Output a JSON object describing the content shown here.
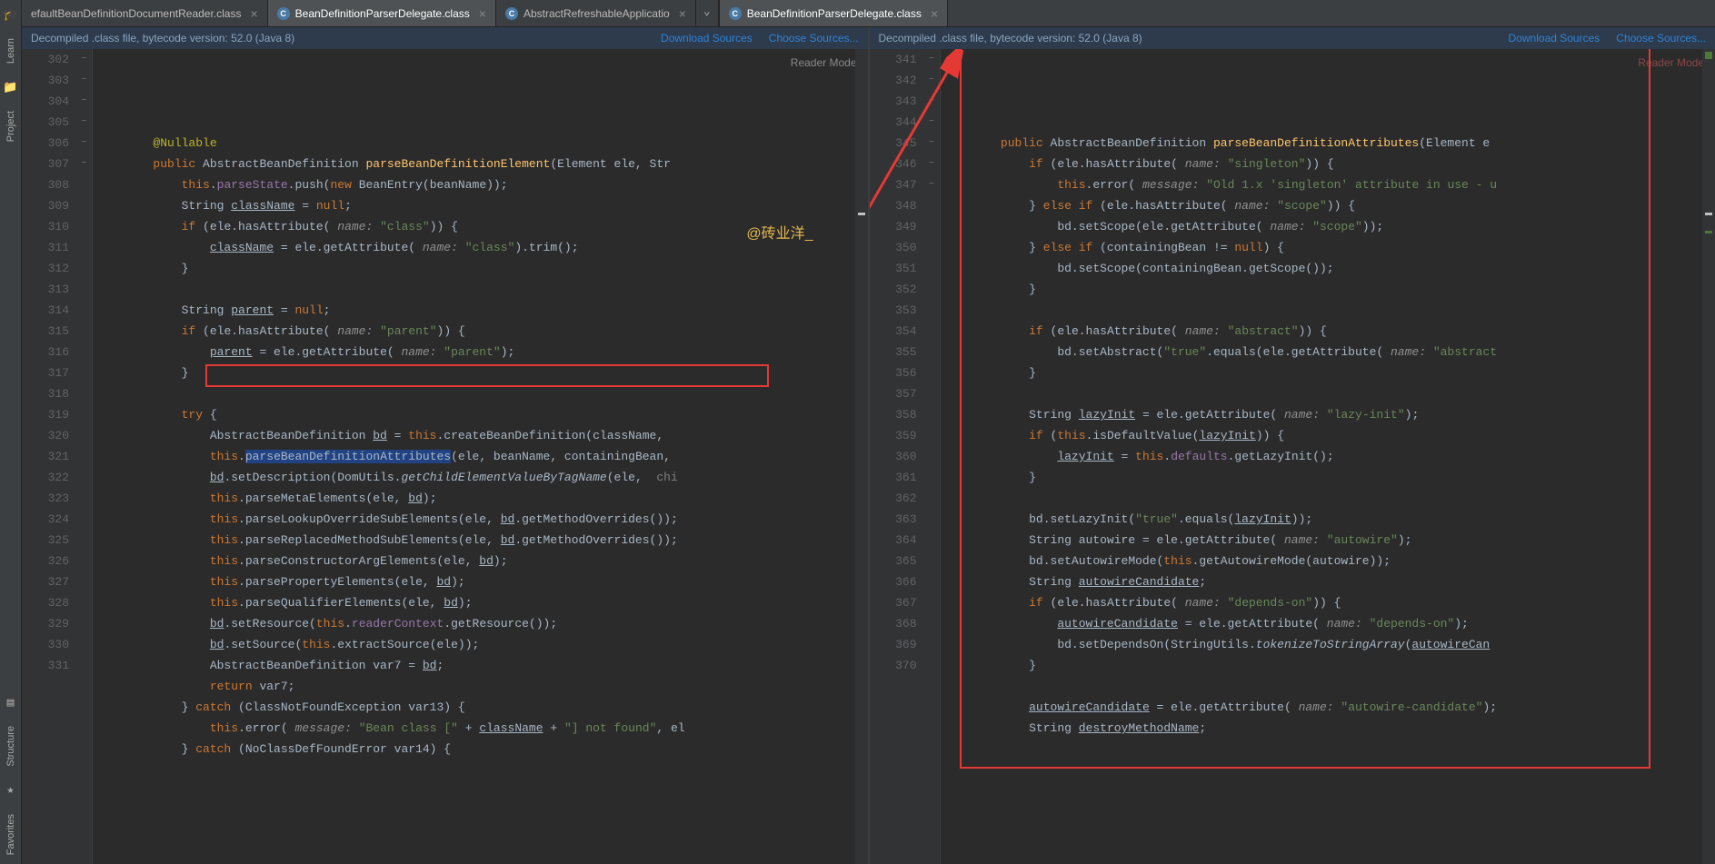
{
  "sidebar": {
    "items": [
      "Learn",
      "Project",
      "Structure",
      "Favorites"
    ]
  },
  "tabs_left": [
    {
      "label": "efaultBeanDefinitionDocumentReader.class",
      "active": false,
      "icon": ""
    },
    {
      "label": "BeanDefinitionParserDelegate.class",
      "active": true,
      "icon": "C"
    },
    {
      "label": "AbstractRefreshableApplicatio",
      "active": false,
      "icon": "C"
    }
  ],
  "tabs_right": [
    {
      "label": "BeanDefinitionParserDelegate.class",
      "active": true,
      "icon": "C"
    }
  ],
  "info": {
    "text": "Decompiled .class file, bytecode version: 52.0 (Java 8)",
    "download": "Download Sources",
    "choose": "Choose Sources..."
  },
  "reader_mode": "Reader Mode",
  "watermark": "@砖业洋_",
  "left": {
    "start": 302,
    "fold": [
      "",
      "−",
      "",
      "",
      "",
      "−",
      "",
      "",
      "",
      "",
      "",
      "−",
      "",
      "",
      "",
      "−",
      "",
      "",
      "",
      "",
      "",
      "",
      "",
      "",
      "",
      "",
      "",
      "−",
      "",
      "−"
    ],
    "lines": [
      "        <span class='ann'>@Nullable</span>",
      "        <span class='kw'>public</span> AbstractBeanDefinition <span class='method'>parseBeanDefinitionElement</span>(Element ele, Str",
      "            <span class='kw'>this</span>.<span class='var'>parseState</span>.push(<span class='kw'>new</span> BeanEntry(beanName));",
      "            String <span class='under'>className</span> = <span class='kw'>null</span>;",
      "            <span class='kw'>if</span> (ele.hasAttribute( <span class='param'>name:</span> <span class='str'>\"class\"</span>)) {",
      "                <span class='under'>className</span> = ele.getAttribute( <span class='param'>name:</span> <span class='str'>\"class\"</span>).trim();",
      "            }",
      "",
      "            String <span class='under'>parent</span> = <span class='kw'>null</span>;",
      "            <span class='kw'>if</span> (ele.hasAttribute( <span class='param'>name:</span> <span class='str'>\"parent\"</span>)) {",
      "                <span class='under'>parent</span> = ele.getAttribute( <span class='param'>name:</span> <span class='str'>\"parent\"</span>);",
      "            }",
      "",
      "            <span class='kw'>try</span> {",
      "                AbstractBeanDefinition <span class='under'>bd</span> = <span class='kw'>this</span>.createBeanDefinition(className, ",
      "                <span class='kw'>this</span>.<span style='background:#214283'>parseBeanDefinitionAttributes</span>(ele, beanName, containingBean,",
      "                <span class='under'>bd</span>.setDescription(DomUtils.<span class='it'>getChildElementValueByTagName</span>(ele,  <span class='com'>chi</span>",
      "                <span class='kw'>this</span>.parseMetaElements(ele, <span class='under'>bd</span>);",
      "                <span class='kw'>this</span>.parseLookupOverrideSubElements(ele, <span class='under'>bd</span>.getMethodOverrides());",
      "                <span class='kw'>this</span>.parseReplacedMethodSubElements(ele, <span class='under'>bd</span>.getMethodOverrides());",
      "                <span class='kw'>this</span>.parseConstructorArgElements(ele, <span class='under'>bd</span>);",
      "                <span class='kw'>this</span>.parsePropertyElements(ele, <span class='under'>bd</span>);",
      "                <span class='kw'>this</span>.parseQualifierElements(ele, <span class='under'>bd</span>);",
      "                <span class='under'>bd</span>.setResource(<span class='kw'>this</span>.<span class='var'>readerContext</span>.getResource());",
      "                <span class='under'>bd</span>.setSource(<span class='kw'>this</span>.extractSource(ele));",
      "                AbstractBeanDefinition var7 = <span class='under'>bd</span>;",
      "                <span class='kw'>return</span> var7;",
      "            } <span class='kw'>catch</span> (ClassNotFoundException var13) {",
      "                <span class='kw'>this</span>.error( <span class='param'>message:</span> <span class='str'>\"Bean class [\"</span> + <span class='under'>className</span> + <span class='str'>\"] not found\"</span>, el",
      "            } <span class='kw'>catch</span> (NoClassDefFoundError var14) {"
    ]
  },
  "right": {
    "start": 341,
    "fold": [
      "",
      "−",
      "−",
      "",
      "−",
      "",
      "",
      "−",
      "",
      "",
      "",
      "",
      "−",
      "",
      "",
      "",
      "",
      "−",
      "",
      "",
      "",
      "",
      "",
      "",
      "",
      "−",
      "",
      "",
      "",
      "",
      ""
    ],
    "lines": [
      "",
      "        <span class='kw'>public</span> AbstractBeanDefinition <span class='method'>parseBeanDefinitionAttributes</span>(Element e",
      "            <span class='kw'>if</span> (ele.hasAttribute( <span class='param'>name:</span> <span class='str'>\"singleton\"</span>)) {",
      "                <span class='kw'>this</span>.error( <span class='param'>message:</span> <span class='str'>\"Old 1.x 'singleton' attribute in use - u</span>",
      "            } <span class='kw'>else if</span> (ele.hasAttribute( <span class='param'>name:</span> <span class='str'>\"scope\"</span>)) {",
      "                bd.setScope(ele.getAttribute( <span class='param'>name:</span> <span class='str'>\"scope\"</span>));",
      "            } <span class='kw'>else if</span> (containingBean != <span class='kw'>null</span>) {",
      "                bd.setScope(containingBean.getScope());",
      "            }",
      "",
      "            <span class='kw'>if</span> (ele.hasAttribute( <span class='param'>name:</span> <span class='str'>\"abstract\"</span>)) {",
      "                bd.setAbstract(<span class='str'>\"true\"</span>.equals(ele.getAttribute( <span class='param'>name:</span> <span class='str'>\"abstract</span>",
      "            }",
      "",
      "            String <span class='under'>lazyInit</span> = ele.getAttribute( <span class='param'>name:</span> <span class='str'>\"lazy-init\"</span>);",
      "            <span class='kw'>if</span> (<span class='kw'>this</span>.isDefaultValue(<span class='under'>lazyInit</span>)) {",
      "                <span class='under'>lazyInit</span> = <span class='kw'>this</span>.<span class='var'>defaults</span>.getLazyInit();",
      "            }",
      "",
      "            bd.setLazyInit(<span class='str'>\"true\"</span>.equals(<span class='under'>lazyInit</span>));",
      "            String autowire = ele.getAttribute( <span class='param'>name:</span> <span class='str'>\"autowire\"</span>);",
      "            bd.setAutowireMode(<span class='kw'>this</span>.getAutowireMode(autowire));",
      "            String <span class='under'>autowireCandidate</span>;",
      "            <span class='kw'>if</span> (ele.hasAttribute( <span class='param'>name:</span> <span class='str'>\"depends-on\"</span>)) {",
      "                <span class='under'>autowireCandidate</span> = ele.getAttribute( <span class='param'>name:</span> <span class='str'>\"depends-on\"</span>);",
      "                bd.setDependsOn(StringUtils.<span class='it'>tokenizeToStringArray</span>(<span class='under'>autowireCan</span>",
      "            }",
      "",
      "            <span class='under'>autowireCandidate</span> = ele.getAttribute( <span class='param'>name:</span> <span class='str'>\"autowire-candidate\"</span>);",
      "            String <span class='under'>destroyMethodName</span>;"
    ]
  }
}
